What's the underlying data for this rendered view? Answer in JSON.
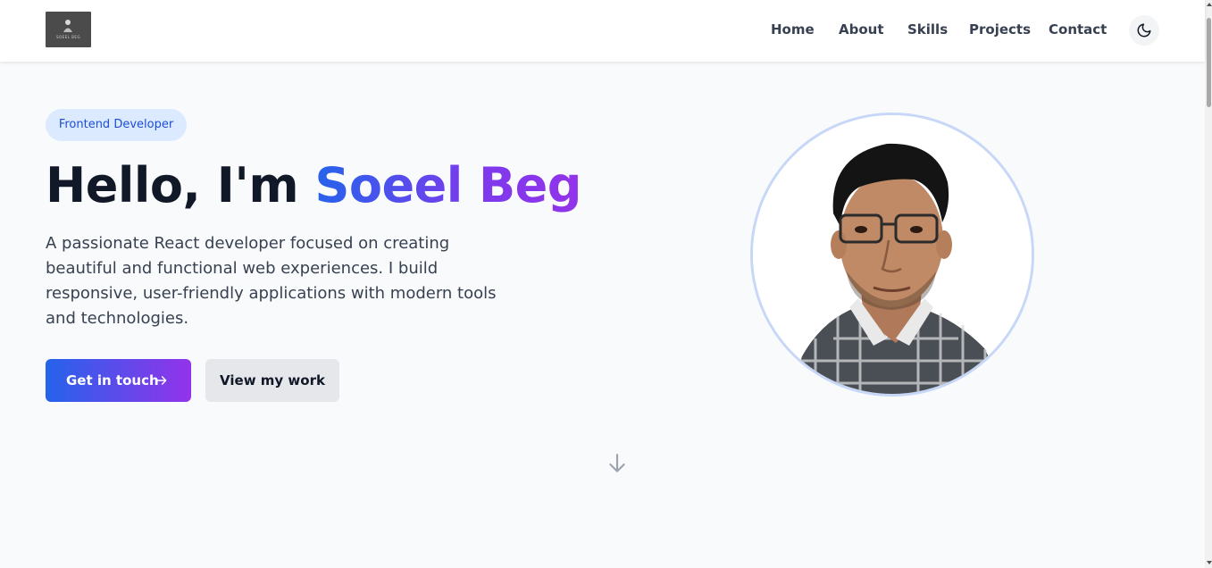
{
  "header": {
    "logo_text": "SOEEL BEG",
    "nav": [
      {
        "label": "Home"
      },
      {
        "label": "About"
      },
      {
        "label": "Skills"
      },
      {
        "label": "Projects"
      },
      {
        "label": "Contact"
      }
    ],
    "theme_toggle_icon": "moon-icon"
  },
  "hero": {
    "badge": "Frontend Developer",
    "greeting": "Hello, I'm",
    "name": "Soeel Beg",
    "intro": "A passionate React developer focused on creating beautiful and functional web experiences. I build responsive, user-friendly applications with modern tools and technologies.",
    "primary_button": "Get in touch",
    "primary_button_icon": "arrow-right-icon",
    "secondary_button": "View my work",
    "scroll_icon": "arrow-down-icon"
  },
  "colors": {
    "accent_blue": "#2563eb",
    "accent_purple": "#9333ea",
    "badge_bg": "#dbeafe",
    "page_bg": "#f9fafb"
  }
}
